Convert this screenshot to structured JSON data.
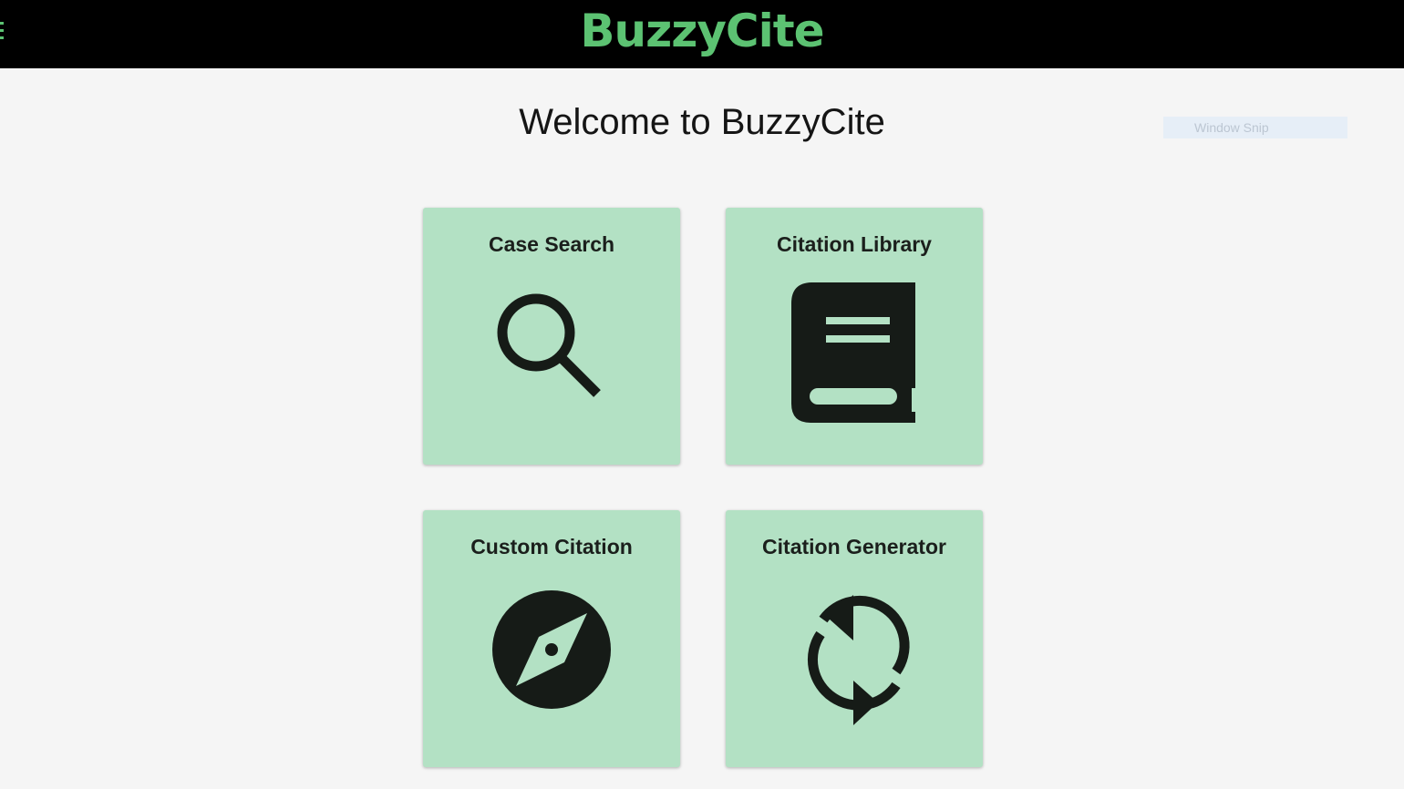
{
  "header": {
    "brand": "BuzzyCite",
    "brand_color": "#5cc272",
    "menu_icon": "hamburger-menu-icon"
  },
  "main": {
    "title": "Welcome to BuzzyCite",
    "cards": [
      {
        "label": "Case Search",
        "icon": "magnifying-glass-icon"
      },
      {
        "label": "Citation Library",
        "icon": "book-icon"
      },
      {
        "label": "Custom Citation",
        "icon": "compass-icon"
      },
      {
        "label": "Citation Generator",
        "icon": "sync-arrows-icon"
      }
    ],
    "card_color": "#b3e1c4",
    "icon_color": "#161b17"
  },
  "overlay": {
    "window_snip_label": "Window Snip"
  }
}
